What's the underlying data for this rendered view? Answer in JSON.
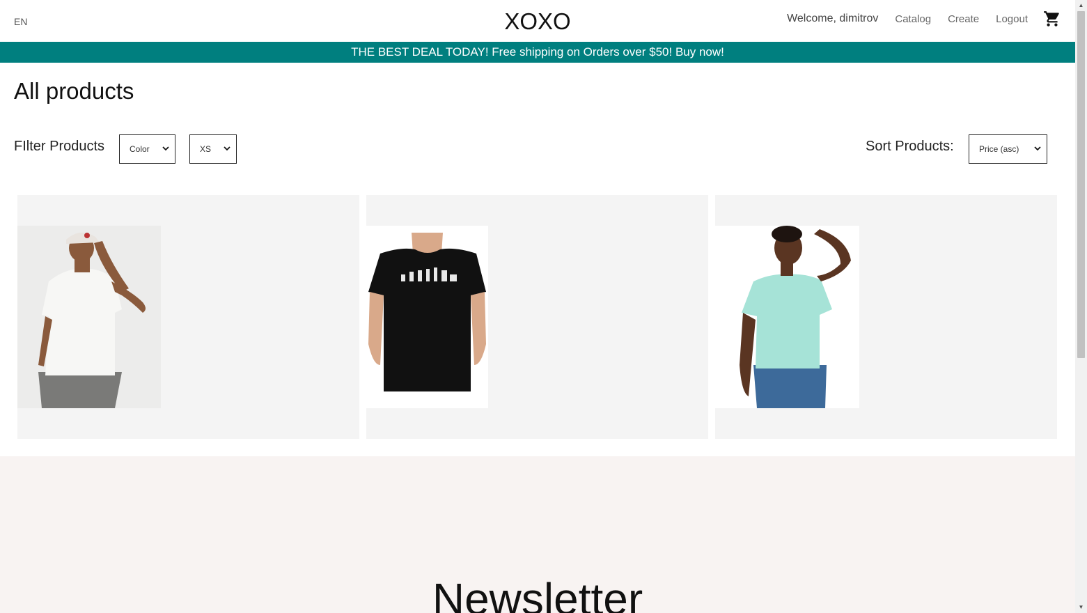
{
  "header": {
    "language": "EN",
    "logo": "XOXO",
    "welcome": "Welcome, dimitrov",
    "nav": {
      "catalog": "Catalog",
      "create": "Create",
      "logout": "Logout"
    },
    "cart_icon": "shopping-cart-icon"
  },
  "banner": {
    "text": "THE BEST DEAL TODAY! Free shipping on Orders over $50! Buy now!",
    "background": "#007f7f"
  },
  "main": {
    "title": "All products",
    "filter_label": "FIlter Products",
    "filters": {
      "color": "Color",
      "size": "XS"
    },
    "sort_label": "Sort Products:",
    "sort_value": "Price (asc)"
  },
  "products": [
    {
      "image": "man-white-tshirt-cap-photo"
    },
    {
      "image": "man-black-evolution-tshirt-photo"
    },
    {
      "image": "woman-mint-tshirt-photo"
    }
  ],
  "newsletter": {
    "title": "Newsletter"
  }
}
